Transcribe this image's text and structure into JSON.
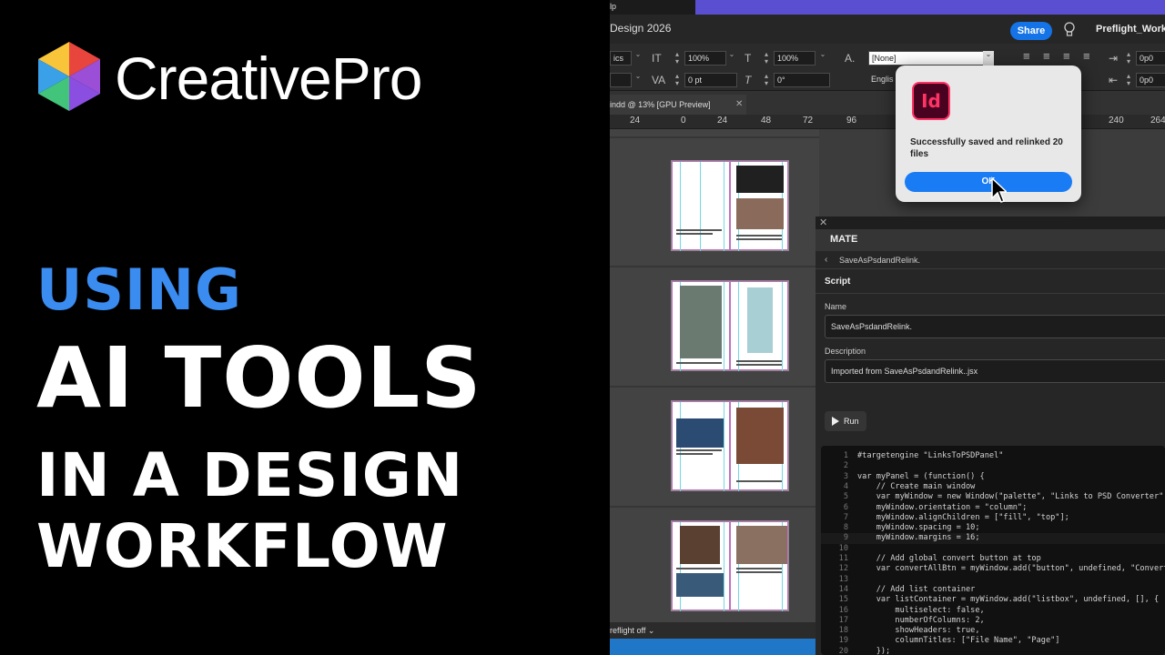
{
  "promo": {
    "brand": "CreativePro",
    "headline": [
      "USING",
      "AI TOOLS",
      "IN A DESIGN",
      "WORKFLOW"
    ],
    "accent_color": "#3b8cf0"
  },
  "app": {
    "menu_fragment": "lp",
    "title": "Design 2026",
    "share_label": "Share",
    "workspace": "Preflight_Work",
    "control": {
      "font_style": "ics",
      "scale_h": "100%",
      "scale_v": "100%",
      "tracking": "0 pt",
      "skew": "0°",
      "char_style": "[None]",
      "language": "Englis",
      "indent_1": "0p0",
      "indent_2": "0p0"
    },
    "doc_tab": "indd @ 13% [GPU Preview]",
    "ruler_ticks": [
      "24",
      "0",
      "24",
      "48",
      "72",
      "96",
      "240",
      "264"
    ],
    "status": "reflight off"
  },
  "dialog": {
    "icon_text": "Id",
    "message": "Successfully saved and relinked 20 files",
    "ok_label": "OK"
  },
  "mate": {
    "title": "MATE",
    "breadcrumb": "SaveAsPsdandRelink.",
    "section": "Script",
    "name_label": "Name",
    "name_value": "SaveAsPsdandRelink.",
    "desc_label": "Description",
    "desc_value": "Imported from SaveAsPsdandRelink..jsx",
    "run_label": "Run",
    "code": [
      {
        "n": "1",
        "t": "#targetengine \"LinksToPSDPanel\""
      },
      {
        "n": "2",
        "t": ""
      },
      {
        "n": "3",
        "t": "var myPanel = (function() {"
      },
      {
        "n": "4",
        "t": "    // Create main window"
      },
      {
        "n": "5",
        "t": "    var myWindow = new Window(\"palette\", \"Links to PSD Converter\", "
      },
      {
        "n": "6",
        "t": "    myWindow.orientation = \"column\";"
      },
      {
        "n": "7",
        "t": "    myWindow.alignChildren = [\"fill\", \"top\"];"
      },
      {
        "n": "8",
        "t": "    myWindow.spacing = 10;"
      },
      {
        "n": "9",
        "t": "    myWindow.margins = 16;"
      },
      {
        "n": "10",
        "t": ""
      },
      {
        "n": "11",
        "t": "    // Add global convert button at top"
      },
      {
        "n": "12",
        "t": "    var convertAllBtn = myWindow.add(\"button\", undefined, \"Convert"
      },
      {
        "n": "13",
        "t": ""
      },
      {
        "n": "14",
        "t": "    // Add list container"
      },
      {
        "n": "15",
        "t": "    var listContainer = myWindow.add(\"listbox\", undefined, [], {"
      },
      {
        "n": "16",
        "t": "        multiselect: false,"
      },
      {
        "n": "17",
        "t": "        numberOfColumns: 2,"
      },
      {
        "n": "18",
        "t": "        showHeaders: true,"
      },
      {
        "n": "19",
        "t": "        columnTitles: [\"File Name\", \"Page\"]"
      },
      {
        "n": "20",
        "t": "    });"
      }
    ]
  }
}
